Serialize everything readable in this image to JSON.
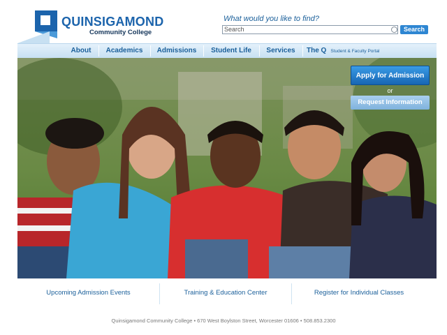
{
  "header": {
    "logo_name": "QUINSIGAMOND",
    "logo_sub": "Community College",
    "find_label": "What would you like to find?",
    "search_placeholder": "Search",
    "search_button": "Search"
  },
  "nav": {
    "items": [
      "About",
      "Academics",
      "Admissions",
      "Student Life",
      "Services",
      "The Q"
    ],
    "the_q_sub": "Student & Faculty Portal"
  },
  "hero": {
    "apply_label": "Apply for Admission",
    "or_label": "or",
    "info_label": "Request Information"
  },
  "links": [
    "Upcoming Admission Events",
    "Training & Education Center",
    "Register for Individual Classes"
  ],
  "footer": "Quinsigamond Community College • 670 West Boylston Street, Worcester 01606 • 508.853.2300",
  "colors": {
    "brand_blue": "#1c64ac",
    "nav_bg": "#c7e0f2",
    "button_blue": "#2e86d2"
  }
}
